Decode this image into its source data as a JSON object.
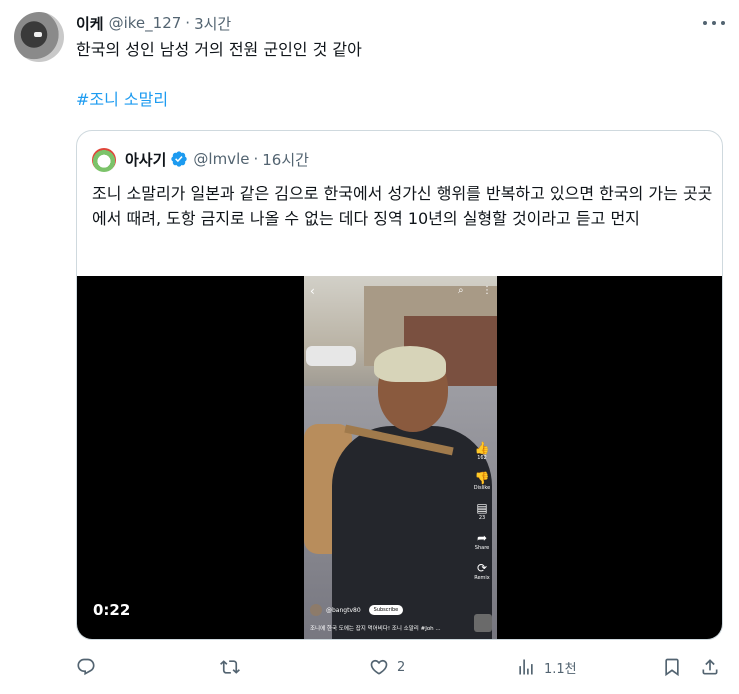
{
  "tweet": {
    "author_name": "이케",
    "author_handle": "@ike_127",
    "separator": "·",
    "time": "3시간",
    "text": "한국의 성인 남성 거의 전원 군인인 것 같아",
    "hashtag": "#조니 소말리"
  },
  "quote": {
    "author_name": "아사기",
    "author_handle": "@lmvle",
    "separator": "·",
    "time": "16시간",
    "text": "조니 소말리가 일본과 같은 김으로 한국에서 성가신 행위를 반복하고 있으면 한국의 가는 곳곳에서 때려, 도항 금지로 나올 수 없는 데다 징역 10년의 실형할 것이라고 듣고 먼지",
    "video": {
      "duration": "0:22",
      "side_icons": [
        {
          "icon": "like-icon",
          "glyph": "👍",
          "label": "162"
        },
        {
          "icon": "dislike-icon",
          "glyph": "👎",
          "label": "Dislike"
        },
        {
          "icon": "comment-icon",
          "glyph": "▤",
          "label": "23"
        },
        {
          "icon": "share-icon",
          "glyph": "➦",
          "label": "Share"
        },
        {
          "icon": "remix-icon",
          "glyph": "⟳",
          "label": "Remix"
        }
      ],
      "channel_name": "@bangtv80",
      "subscribe_label": "Subscribe",
      "caption": "조니에 한국 도에는 잡지 먹어비다! 조니 소말리 #Joh ..."
    }
  },
  "actions": {
    "reply_count": "",
    "retweet_count": "",
    "like_count": "2",
    "views_count": "1.1천"
  },
  "colors": {
    "link": "#1d9bf0",
    "secondary_text": "#536471",
    "border": "#cfd9de",
    "verified": "#1d9bf0"
  }
}
